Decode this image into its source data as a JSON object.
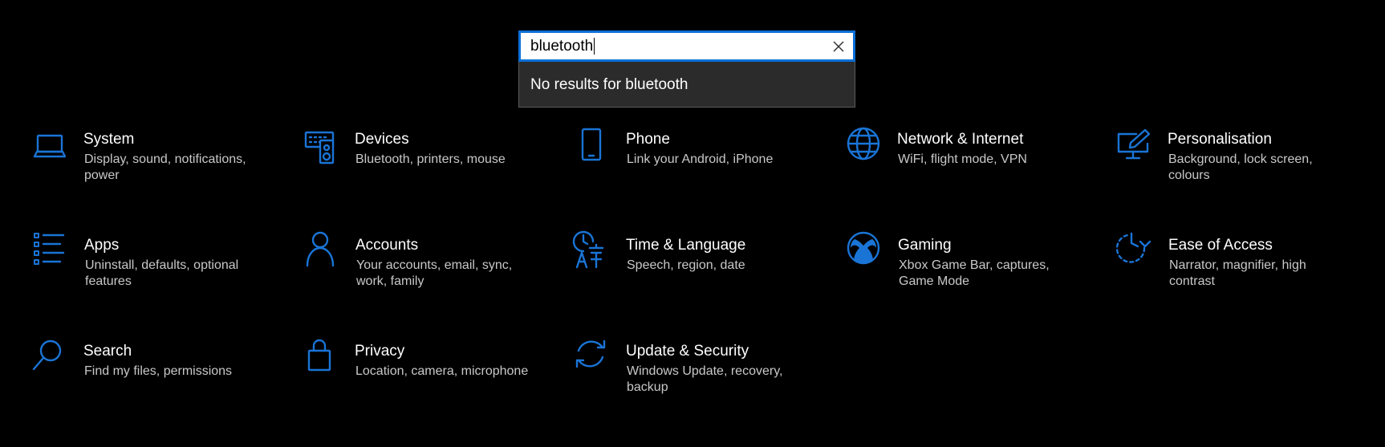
{
  "search": {
    "value": "bluetooth",
    "dropdown_message": "No results for bluetooth"
  },
  "colors": {
    "accent": "#1a74d6",
    "background": "#000000",
    "dropdown_bg": "#2b2b2b"
  },
  "categories": [
    {
      "title": "System",
      "desc": "Display, sound, notifications, power",
      "icon": "laptop-icon"
    },
    {
      "title": "Devices",
      "desc": "Bluetooth, printers, mouse",
      "icon": "keyboard-speaker-icon"
    },
    {
      "title": "Phone",
      "desc": "Link your Android, iPhone",
      "icon": "phone-icon"
    },
    {
      "title": "Network & Internet",
      "desc": "WiFi, flight mode, VPN",
      "icon": "globe-icon"
    },
    {
      "title": "Personalisation",
      "desc": "Background, lock screen, colours",
      "icon": "paint-monitor-icon"
    },
    {
      "title": "Apps",
      "desc": "Uninstall, defaults, optional features",
      "icon": "apps-list-icon"
    },
    {
      "title": "Accounts",
      "desc": "Your accounts, email, sync, work, family",
      "icon": "person-icon"
    },
    {
      "title": "Time & Language",
      "desc": "Speech, region, date",
      "icon": "time-language-icon"
    },
    {
      "title": "Gaming",
      "desc": "Xbox Game Bar, captures, Game Mode",
      "icon": "xbox-icon"
    },
    {
      "title": "Ease of Access",
      "desc": "Narrator, magnifier, high contrast",
      "icon": "ease-of-access-icon"
    },
    {
      "title": "Search",
      "desc": "Find my files, permissions",
      "icon": "magnifier-icon"
    },
    {
      "title": "Privacy",
      "desc": "Location, camera, microphone",
      "icon": "lock-icon"
    },
    {
      "title": "Update & Security",
      "desc": "Windows Update, recovery, backup",
      "icon": "sync-arrows-icon"
    }
  ]
}
